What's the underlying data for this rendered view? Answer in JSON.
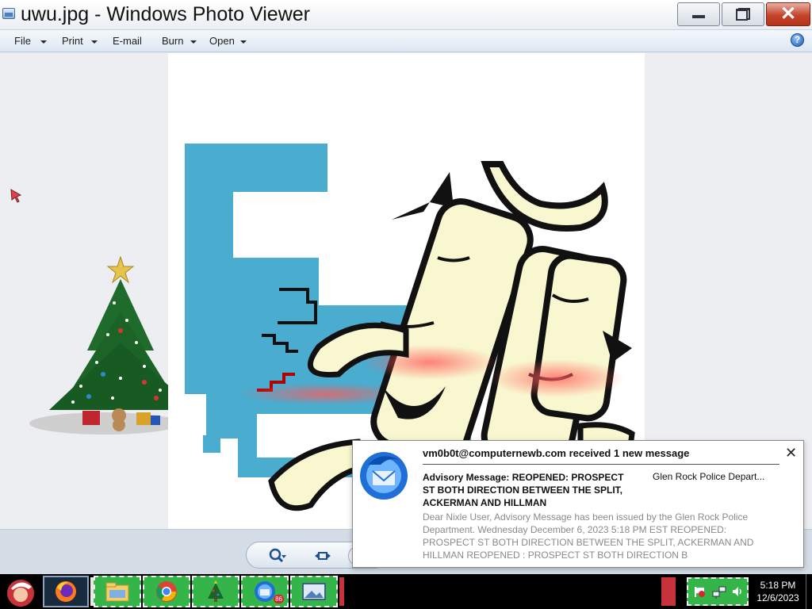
{
  "window": {
    "title": "uwu.jpg - Windows Photo Viewer"
  },
  "menu": {
    "items": [
      {
        "label": "File",
        "has_arrow": true
      },
      {
        "label": "Print",
        "has_arrow": true
      },
      {
        "label": "E-mail",
        "has_arrow": false
      },
      {
        "label": "Burn",
        "has_arrow": true
      },
      {
        "label": "Open",
        "has_arrow": true
      }
    ],
    "help_icon": "?"
  },
  "viewer": {
    "image_name": "uwu.jpg",
    "controls": [
      "zoom-icon",
      "fit-to-window-icon",
      "next-icon"
    ]
  },
  "notification": {
    "header": "vm0b0t@computernewb.com received 1 new message",
    "subject": "Advisory Message: REOPENED: PROSPECT ST BOTH DIRECTION BETWEEN THE SPLIT, ACKERMAN AND HILLMAN",
    "sender": "Glen Rock Police Depart...",
    "body": "Dear Nixle User, Advisory Message has been issued by the Glen Rock Police Department. Wednesday December 6, 2023 5:18 PM EST REOPENED: PROSPECT ST BOTH DIRECTION BETWEEN THE SPLIT, ACKERMAN AND HILLMAN REOPENED : PROSPECT ST BOTH DIRECTION B",
    "close_label": "✕",
    "app_icon": "thunderbird-icon"
  },
  "taskbar": {
    "items": [
      "start-orb-santa-icon",
      "firefox-icon",
      "file-explorer-icon",
      "chrome-icon",
      "christmas-tree-icon",
      "thunderbird-icon",
      "photo-viewer-icon"
    ],
    "thunderbird_badge": "86",
    "clock_time": "5:18 PM",
    "clock_date": "12/6/2023"
  },
  "colors": {
    "taskbar_green": "#35b44a",
    "photo_blue": "#4aaccf",
    "character_cream": "#f9f7cf",
    "close_red": "#c4442c"
  }
}
